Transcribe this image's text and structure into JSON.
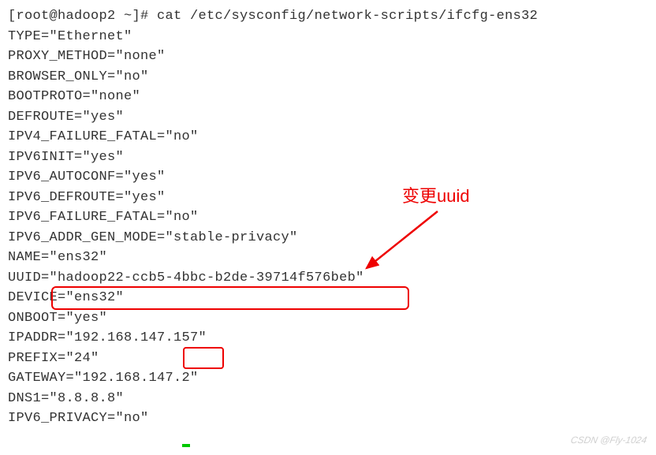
{
  "prompt": "[root@hadoop2 ~]# ",
  "command": "cat /etc/sysconfig/network-scripts/ifcfg-ens32",
  "lines": [
    "TYPE=\"Ethernet\"",
    "PROXY_METHOD=\"none\"",
    "BROWSER_ONLY=\"no\"",
    "BOOTPROTO=\"none\"",
    "DEFROUTE=\"yes\"",
    "IPV4_FAILURE_FATAL=\"no\"",
    "IPV6INIT=\"yes\"",
    "IPV6_AUTOCONF=\"yes\"",
    "IPV6_DEFROUTE=\"yes\"",
    "IPV6_FAILURE_FATAL=\"no\"",
    "IPV6_ADDR_GEN_MODE=\"stable-privacy\"",
    "NAME=\"ens32\"",
    "UUID=\"hadoop22-ccb5-4bbc-b2de-39714f576beb\"",
    "DEVICE=\"ens32\"",
    "ONBOOT=\"yes\"",
    "IPADDR=\"192.168.147.157\"",
    "PREFIX=\"24\"",
    "GATEWAY=\"192.168.147.2\"",
    "DNS1=\"8.8.8.8\"",
    "IPV6_PRIVACY=\"no\""
  ],
  "annotation_label": "变更uuid",
  "watermark": "CSDN @Fly-1024"
}
